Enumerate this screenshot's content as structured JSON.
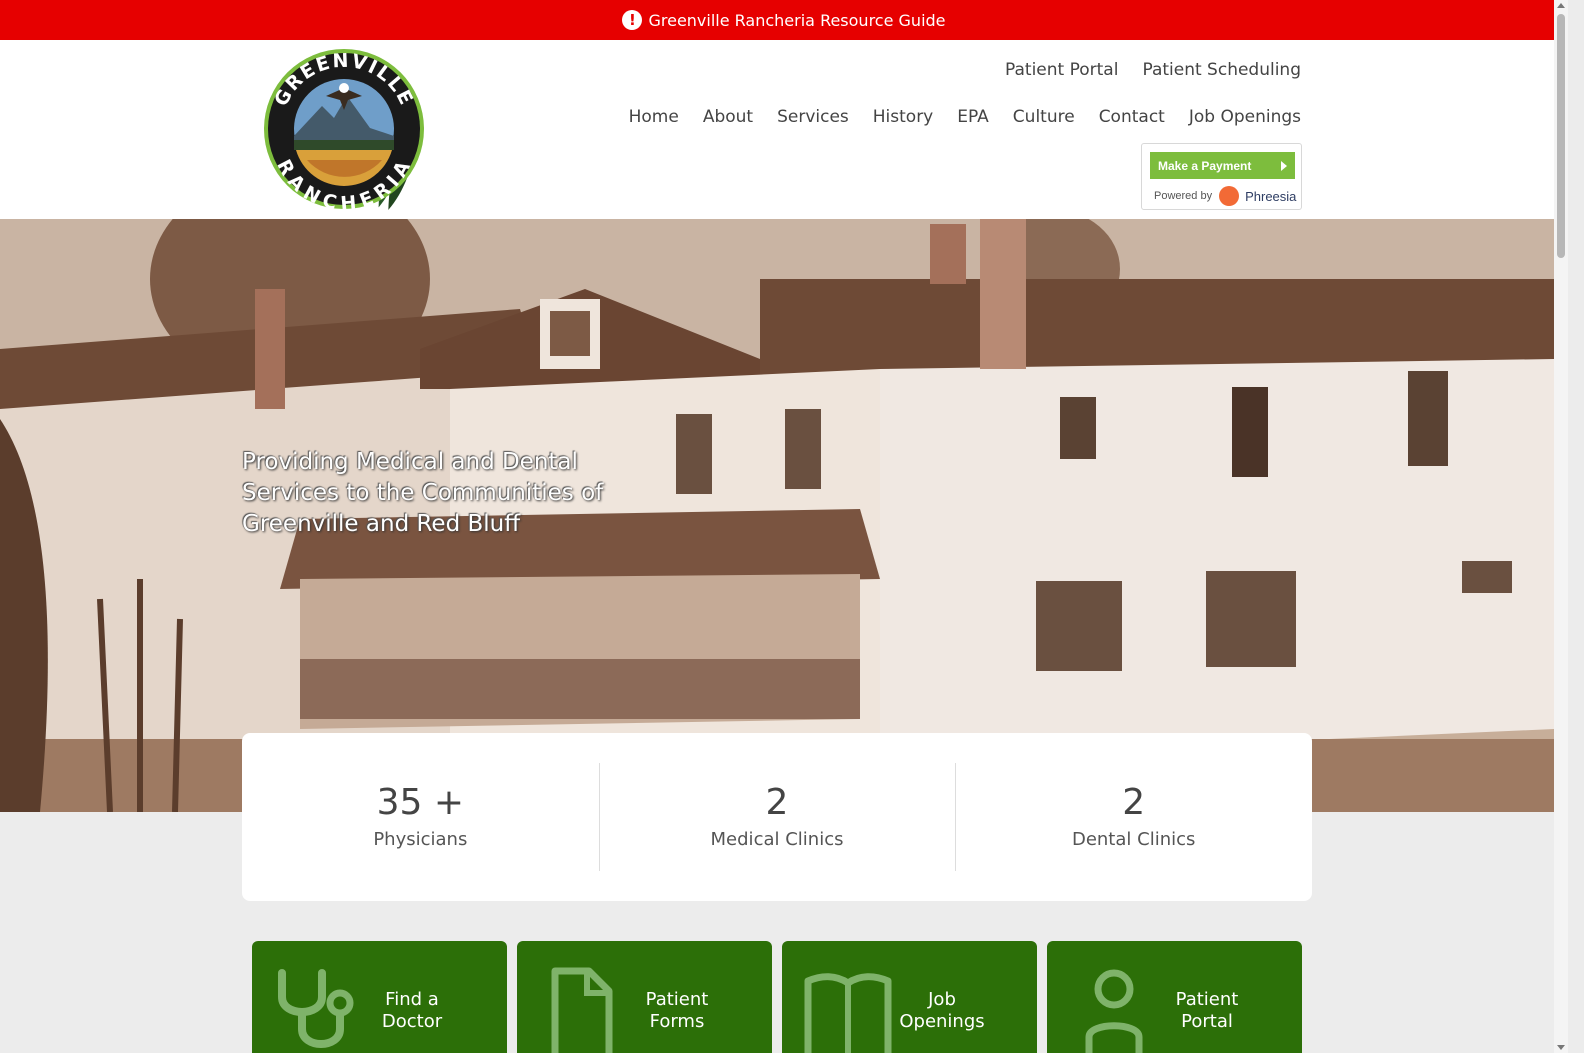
{
  "alert": {
    "icon": "exclamation-icon",
    "text": "Greenville Rancheria Resource Guide"
  },
  "logo": {
    "top_text": "GREENVILLE",
    "bottom_text": "RANCHERIA"
  },
  "top_links": [
    "Patient Portal",
    "Patient Scheduling"
  ],
  "nav": [
    "Home",
    "About",
    "Services",
    "History",
    "EPA",
    "Culture",
    "Contact",
    "Job Openings"
  ],
  "payment": {
    "button_label": "Make a Payment",
    "powered_by": "Powered by",
    "provider": "Phreesia",
    "accent": "#7dbd3d"
  },
  "hero": {
    "tagline": "Providing Medical and Dental Services to the Communities of Greenville and Red Bluff"
  },
  "stats": [
    {
      "value": "35 +",
      "label": "Physicians"
    },
    {
      "value": "2",
      "label": "Medical Clinics"
    },
    {
      "value": "2",
      "label": "Dental Clinics"
    }
  ],
  "tiles": [
    {
      "icon": "stethoscope-icon",
      "label": "Find a Doctor"
    },
    {
      "icon": "document-icon",
      "label": "Patient Forms"
    },
    {
      "icon": "book-icon",
      "label": "Job Openings"
    },
    {
      "icon": "user-icon",
      "label": "Patient Portal"
    }
  ],
  "colors": {
    "alert": "#e60000",
    "tile_green": "#2c6f08",
    "page_bg": "#ececec"
  }
}
